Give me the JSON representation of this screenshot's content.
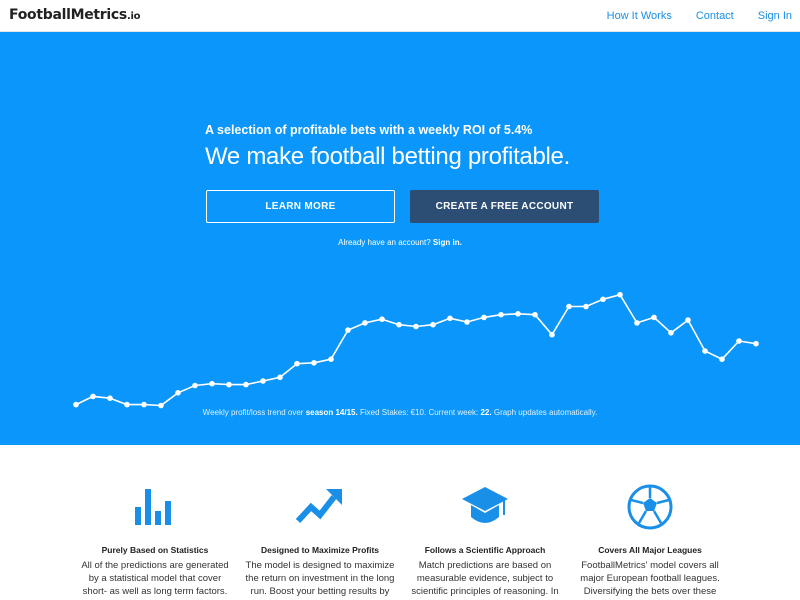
{
  "brand": {
    "name": "FootballMetrics",
    "tld": ".io"
  },
  "nav": {
    "links": [
      "How It Works",
      "Contact",
      "Sign In"
    ]
  },
  "hero": {
    "tagline": "A selection of profitable bets with a weekly ROI of 5.4%",
    "headline": "We make football betting profitable.",
    "learn_more": "LEARN MORE",
    "create_account": "CREATE A FREE ACCOUNT",
    "already_text": "Already have an account?",
    "sign_in_link": "Sign in.",
    "caption_prefix": "Weekly profit/loss trend over",
    "caption_season": "season 14/15.",
    "caption_stakes": "Fixed Stakes: €10. Current week:",
    "caption_week": "22.",
    "caption_suffix": "Graph updates automatically."
  },
  "chart_data": {
    "type": "line",
    "values": [
      1,
      10,
      8,
      1,
      1,
      0,
      14,
      22,
      24,
      23,
      23,
      27,
      31,
      46,
      47,
      51,
      83,
      91,
      95,
      89,
      87,
      89,
      96,
      92,
      97,
      100,
      101,
      100,
      78,
      109,
      109,
      117,
      122,
      91,
      97,
      80,
      94,
      60,
      51,
      71,
      68
    ],
    "ylim": [
      -5,
      125
    ],
    "colors": {
      "line": "#ffffff",
      "point": "#ffffff"
    }
  },
  "features": [
    {
      "icon": "bar-chart-icon",
      "title": "Purely Based on Statistics",
      "lines": [
        "All of the predictions are generated",
        "by a statistical model that cover",
        "short- as well as long term factors."
      ]
    },
    {
      "icon": "trend-up-arrow-icon",
      "title": "Designed to Maximize Profits",
      "lines": [
        "The model is designed to maximize",
        "the return on investment in the long",
        "run. Boost your betting results by"
      ]
    },
    {
      "icon": "graduation-cap-icon",
      "title": "Follows a Scientific Approach",
      "lines": [
        "Match predictions are based on",
        "measurable evidence, subject to",
        "scientific principles of reasoning. In"
      ]
    },
    {
      "icon": "soccer-ball-icon",
      "title": "Covers All Major Leagues",
      "lines": [
        "FootballMetrics' model covers all",
        "major European football leagues.",
        "Diversifying the bets over these"
      ]
    }
  ],
  "colors": {
    "accent": "#0a96fa",
    "button_dark": "#2c4d74",
    "link": "#1a8fe8",
    "icon_blue": "#1a8fe8"
  }
}
